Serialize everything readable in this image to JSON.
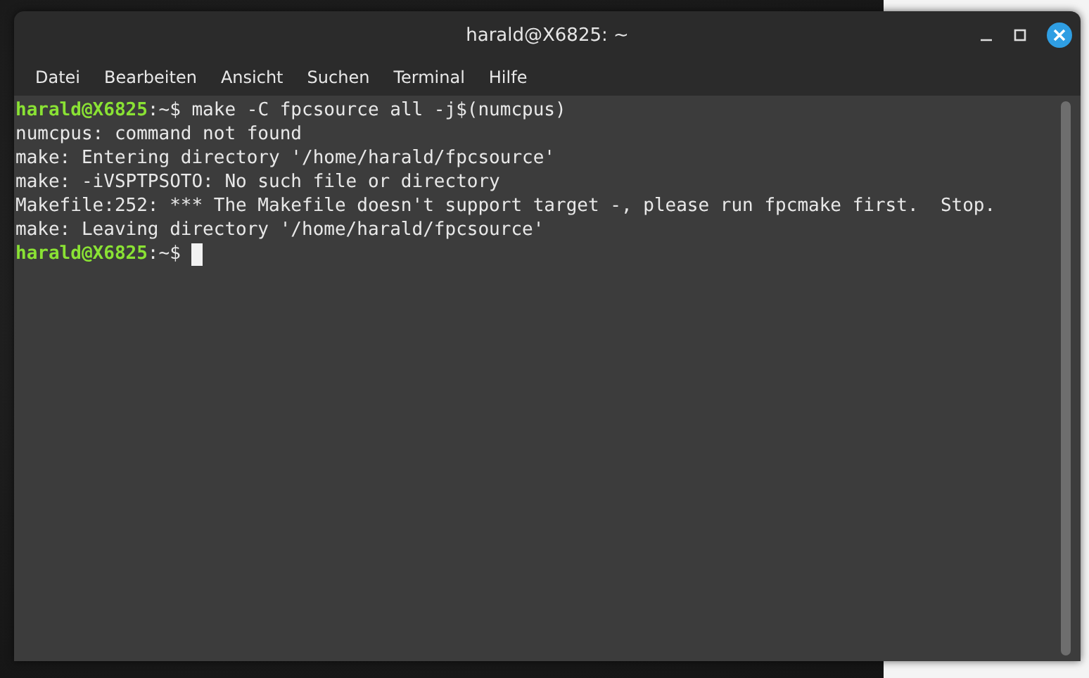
{
  "window": {
    "title": "harald@X6825: ~",
    "buttons": [
      {
        "kind": "minimize"
      },
      {
        "kind": "maximize"
      },
      {
        "kind": "close"
      }
    ]
  },
  "menu": [
    "Datei",
    "Bearbeiten",
    "Ansicht",
    "Suchen",
    "Terminal",
    "Hilfe"
  ],
  "terminal": {
    "lines": [
      {
        "kind": "prompt",
        "user_host": "harald@X6825",
        "path": ":~$",
        "command": " make -C fpcsource all -j$(numcpus)",
        "cursor": false
      },
      {
        "kind": "output",
        "text": "numcpus: command not found"
      },
      {
        "kind": "output",
        "text": "make: Entering directory '/home/harald/fpcsource'"
      },
      {
        "kind": "output",
        "text": "make: -iVSPTPSOTO: No such file or directory"
      },
      {
        "kind": "output",
        "text": "Makefile:252: *** The Makefile doesn't support target -, please run fpcmake first.  Stop."
      },
      {
        "kind": "output",
        "text": "make: Leaving directory '/home/harald/fpcsource'"
      },
      {
        "kind": "prompt",
        "user_host": "harald@X6825",
        "path": ":~$",
        "cursor": true
      }
    ]
  }
}
